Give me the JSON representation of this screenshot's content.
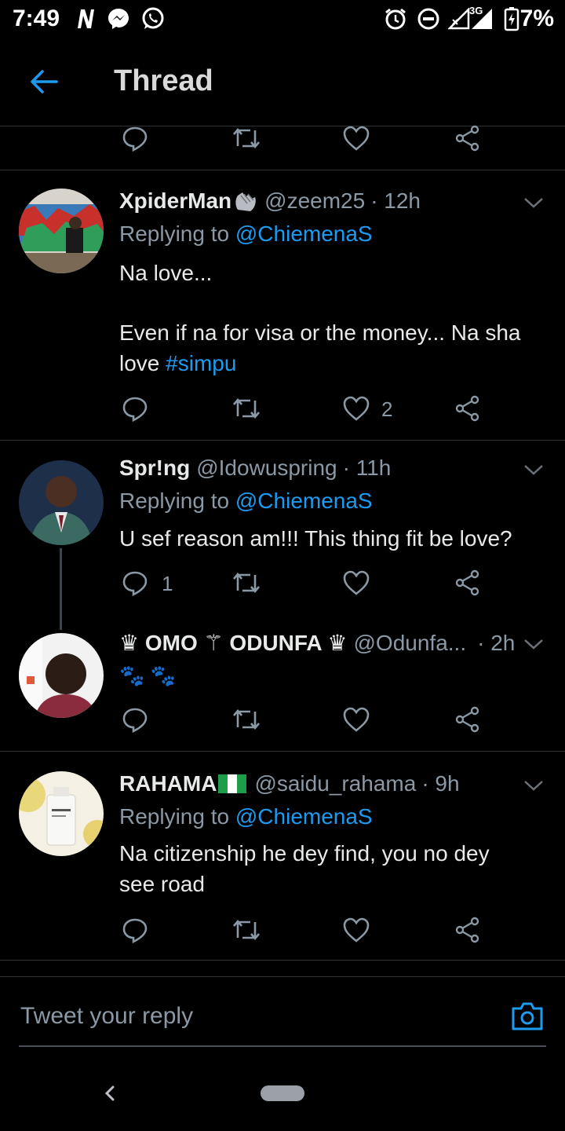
{
  "status_bar": {
    "time": "7:49",
    "battery": "7%",
    "network": "3G"
  },
  "header": {
    "title": "Thread"
  },
  "tweets": [
    {
      "name": "XpiderMan",
      "handle": "@zeem25",
      "time": "· 12h",
      "replying_prefix": "Replying to ",
      "replying_to": "@ChiemenaS",
      "text_1": "Na love...",
      "text_2": "Even if na for visa or the money... Na sha",
      "text_3": "love ",
      "hashtag": "#simpu",
      "likes": "2"
    },
    {
      "name": "Spr!ng",
      "handle": "@Idowuspring",
      "time": "· 11h",
      "replying_prefix": "Replying to ",
      "replying_to": "@ChiemenaS",
      "text_1": "U sef reason am!!! This thing fit be love?",
      "replies": "1"
    },
    {
      "name": "♛ OMO ⚚ ODUNFA ♛",
      "handle": "@Odunfa...",
      "time": "· 2h",
      "text_1": "🐾 🐾"
    },
    {
      "name": "RAHAMA",
      "handle": "@saidu_rahama",
      "time": "· 9h",
      "replying_prefix": "Replying to ",
      "replying_to": "@ChiemenaS",
      "text_1": "Na citizenship he dey find, you no dey",
      "text_2": "see road"
    }
  ],
  "reply_box": {
    "placeholder": "Tweet your reply"
  },
  "colors": {
    "accent": "#1d9bf0",
    "background": "#000000",
    "muted": "#8b98a5"
  }
}
